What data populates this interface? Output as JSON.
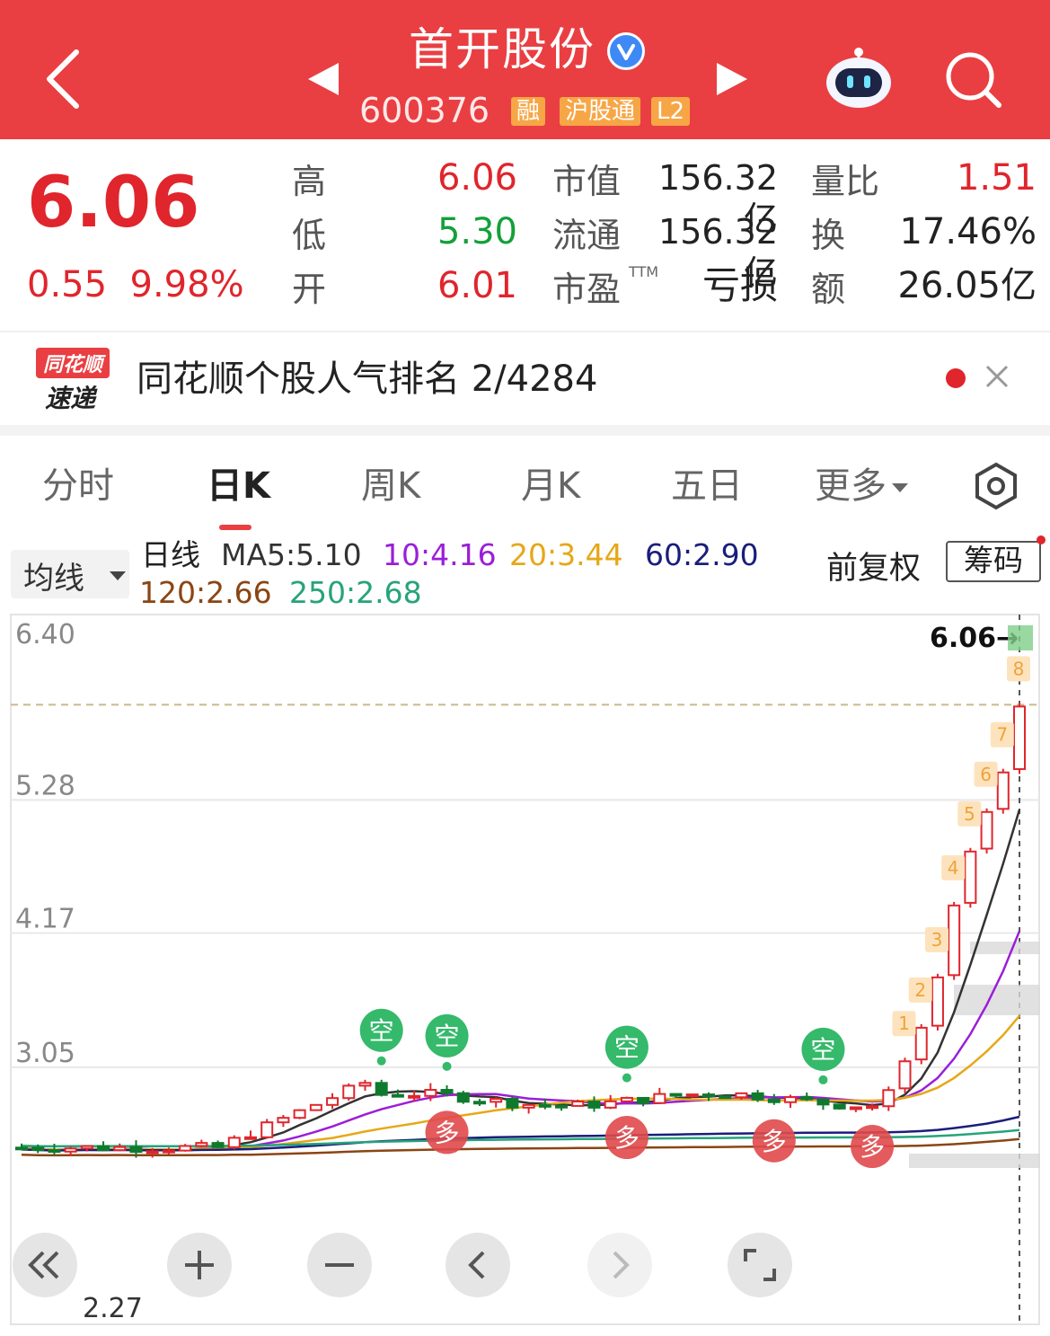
{
  "header": {
    "name": "首开股份",
    "code": "600376",
    "tags": [
      "融",
      "沪股通",
      "L2"
    ]
  },
  "quote": {
    "price": "6.06",
    "change": "0.55",
    "change_pct": "9.98%",
    "high_label": "高",
    "high": "6.06",
    "low_label": "低",
    "low": "5.30",
    "open_label": "开",
    "open": "6.01",
    "mktcap_label": "市值",
    "mktcap": "156.32亿",
    "float_label": "流通",
    "float": "156.32亿",
    "pe_label": "市盈",
    "pe_sup": "TTM",
    "pe": "亏损",
    "vr_label": "量比",
    "vr": "1.51",
    "turn_label": "换",
    "turn": "17.46%",
    "amt_label": "额",
    "amt": "26.05亿"
  },
  "news": {
    "logo_top": "同花顺",
    "logo_bottom": "速递",
    "text": "同花顺个股人气排名 2/4284"
  },
  "tabs": [
    "分时",
    "日K",
    "周K",
    "月K",
    "五日",
    "更多"
  ],
  "ma_row": {
    "select": "均线",
    "line_label": "日线",
    "ma5": "MA5:5.10",
    "ma10": "10:4.16",
    "ma20": "20:3.44",
    "ma60": "60:2.90",
    "ma120": "120:2.66",
    "ma250": "250:2.68",
    "adjust": "前复权",
    "chips": "筹码"
  },
  "colors": {
    "ma5": "#333333",
    "ma10": "#9b1ed8",
    "ma20": "#e6a817",
    "ma60": "#1a1e7a",
    "ma120": "#8b4513",
    "ma250": "#27a37b",
    "up": "#e0252c",
    "down": "#0f7a2e",
    "header": "#e93f42"
  },
  "chart_data": {
    "type": "candlestick",
    "y_ticks": [
      "6.40",
      "5.28",
      "4.17",
      "3.05"
    ],
    "ylim": [
      1.94,
      6.4
    ],
    "last_price_label": "6.06",
    "min_label": "2.27",
    "streak_labels": [
      "1",
      "2",
      "3",
      "4",
      "5",
      "6",
      "7",
      "8"
    ],
    "signal_short": "空",
    "signal_long": "多",
    "recent_closes": [
      2.86,
      3.1,
      3.38,
      3.8,
      4.4,
      4.85,
      5.18,
      5.51,
      6.06
    ]
  }
}
